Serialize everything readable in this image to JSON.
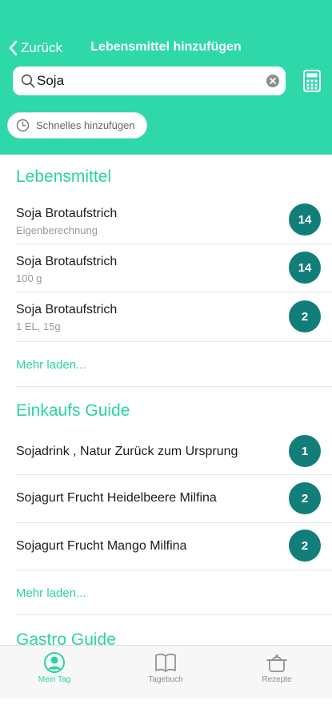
{
  "header": {
    "back_label": "Zurück",
    "title": "Lebensmittel hinzufügen",
    "search_value": "Soja",
    "quick_add_label": "Schnelles hinzufügen"
  },
  "sections": {
    "lebensmittel": {
      "title": "Lebensmittel",
      "items": [
        {
          "name": "Soja Brotaufstrich",
          "detail": "Eigenberechnung",
          "points": "14"
        },
        {
          "name": "Soja Brotaufstrich",
          "detail": "100 g",
          "points": "14"
        },
        {
          "name": "Soja Brotaufstrich",
          "detail": "1 EL, 15g",
          "points": "2"
        }
      ],
      "more_label": "Mehr laden..."
    },
    "einkaufs": {
      "title": "Einkaufs Guide",
      "items": [
        {
          "name": "Sojadrink , Natur Zurück zum Ursprung",
          "points": "1"
        },
        {
          "name": "Sojagurt Frucht Heidelbeere Milfina",
          "points": "2"
        },
        {
          "name": "Sojagurt Frucht Mango Milfina",
          "points": "2"
        }
      ],
      "more_label": "Mehr laden..."
    },
    "gastro": {
      "title": "Gastro Guide"
    }
  },
  "tabs": [
    {
      "label": "Mein Tag",
      "icon": "user-circle-icon"
    },
    {
      "label": "Tagebuch",
      "icon": "book-icon"
    },
    {
      "label": "Rezepte",
      "icon": "cooking-pot-icon"
    }
  ],
  "colors": {
    "header": "#2fd8a9",
    "accent": "#2bd3a2",
    "badge": "#127e7a"
  }
}
